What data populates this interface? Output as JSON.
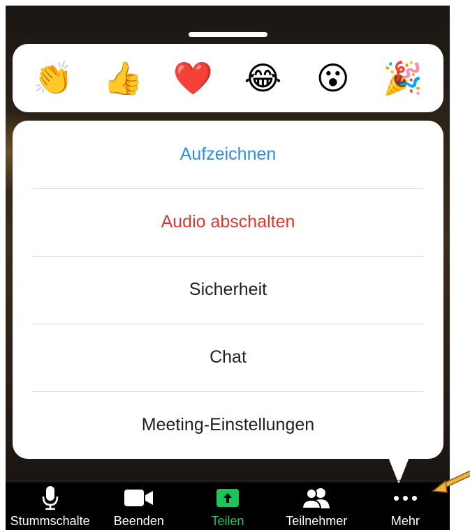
{
  "reactions": [
    {
      "name": "clap-emoji",
      "glyph": "👏"
    },
    {
      "name": "thumbs-up-emoji",
      "glyph": "👍"
    },
    {
      "name": "heart-emoji",
      "glyph": "❤️"
    },
    {
      "name": "tears-of-joy-emoji",
      "glyph": "😂"
    },
    {
      "name": "surprised-emoji",
      "glyph": "😮"
    },
    {
      "name": "party-popper-emoji",
      "glyph": "🎉"
    }
  ],
  "menu": {
    "record": "Aufzeichnen",
    "mute_audio": "Audio abschalten",
    "security": "Sicherheit",
    "chat": "Chat",
    "meeting_settings": "Meeting-Einstellungen"
  },
  "toolbar": {
    "mute": "Stummschalte",
    "stop_video": "Beenden",
    "share": "Teilen",
    "participants": "Teilnehmer",
    "more": "Mehr"
  },
  "colors": {
    "record_text": "#2d8ce3",
    "mute_audio_text": "#d83a31",
    "share_accent": "#20c35a",
    "arrow": "#f0b43a"
  },
  "icons": {
    "mute": "microphone-icon",
    "stop_video": "video-camera-icon",
    "share": "share-arrow-icon",
    "participants": "participants-icon",
    "more": "more-dots-icon",
    "annotation": "pointer-arrow-icon"
  }
}
